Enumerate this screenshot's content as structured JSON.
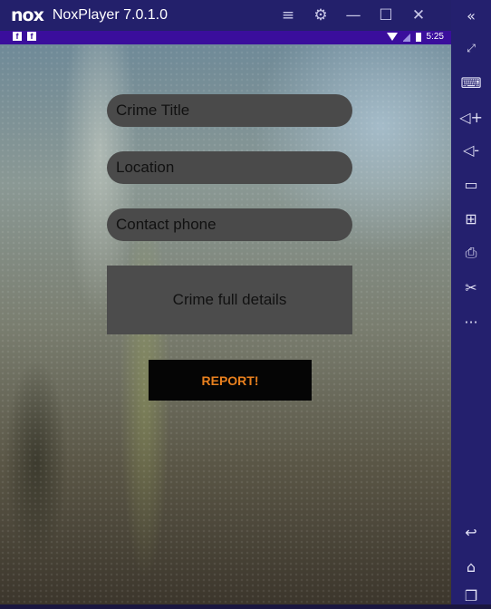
{
  "window": {
    "logo": "nox",
    "title": "NoxPlayer 7.0.1.0",
    "controls": [
      "menu-icon",
      "gear-icon",
      "minimize-icon",
      "maximize-icon",
      "close-icon",
      "collapse-icon"
    ]
  },
  "statusbar": {
    "left_icons": [
      "f",
      "f"
    ],
    "time": "5:25"
  },
  "form": {
    "title_placeholder": "Crime Title",
    "location_placeholder": "Location",
    "phone_placeholder": "Contact phone",
    "details_placeholder": "Crime full details",
    "report_label": "REPORT!"
  },
  "toolbar": {
    "items": [
      "fullscreen-icon",
      "keyboard-icon",
      "volume-up-icon",
      "volume-down-icon",
      "screen-icon",
      "apk-install-icon",
      "printer-icon",
      "scissors-icon",
      "more-icon",
      "back-icon",
      "home-icon",
      "recent-apps-icon"
    ]
  },
  "colors": {
    "titlebar": "#23206b",
    "statusbar": "#3a0e9c",
    "field_bg": "#4a4a4a",
    "button_bg": "#050505",
    "button_text": "#e8801e"
  }
}
